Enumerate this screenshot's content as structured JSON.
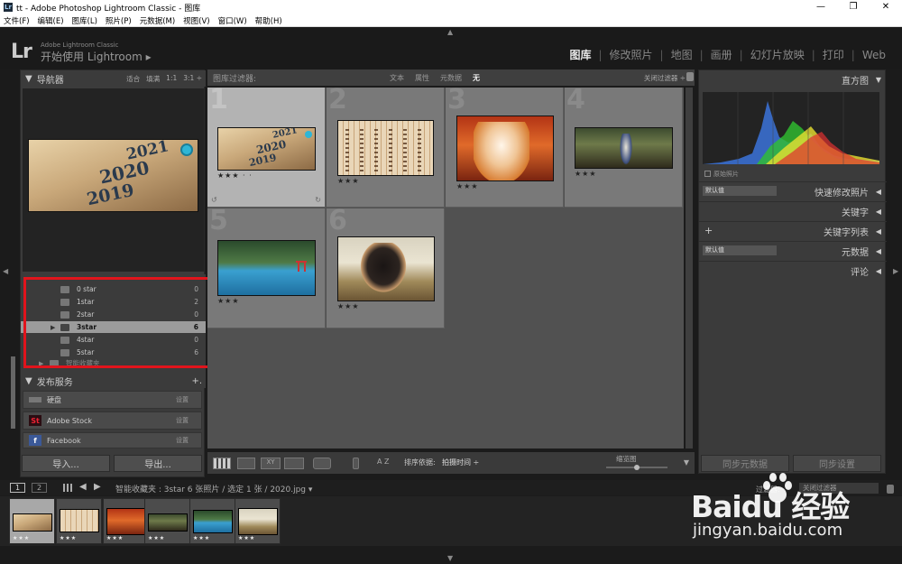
{
  "window": {
    "title": "tt - Adobe Photoshop Lightroom Classic - 图库",
    "controls": [
      "—",
      "❐",
      "✕"
    ],
    "icon": "Lr"
  },
  "menu": [
    "文件(F)",
    "编辑(E)",
    "图库(L)",
    "照片(P)",
    "元数据(M)",
    "视图(V)",
    "窗口(W)",
    "帮助(H)"
  ],
  "identity": {
    "logo": "Lr",
    "small": "Adobe Lightroom Classic",
    "big": "开始使用 Lightroom ▸"
  },
  "modules": [
    {
      "label": "图库",
      "active": true
    },
    {
      "label": "修改照片",
      "active": false
    },
    {
      "label": "地图",
      "active": false
    },
    {
      "label": "画册",
      "active": false
    },
    {
      "label": "幻灯片放映",
      "active": false
    },
    {
      "label": "打印",
      "active": false
    },
    {
      "label": "Web",
      "active": false
    }
  ],
  "navigator": {
    "title": "导航器",
    "zoom": [
      "适合",
      "填满",
      "1:1",
      "3:1 ÷"
    ],
    "preview_text": [
      "2021",
      "2020",
      "2019"
    ]
  },
  "collections": {
    "items": [
      {
        "name": "0 star",
        "count": "0",
        "selected": false
      },
      {
        "name": "1star",
        "count": "2",
        "selected": false
      },
      {
        "name": "2star",
        "count": "0",
        "selected": false
      },
      {
        "name": "3star",
        "count": "6",
        "selected": true
      },
      {
        "name": "4star",
        "count": "0",
        "selected": false
      },
      {
        "name": "5star",
        "count": "6",
        "selected": false
      }
    ],
    "partial_bottom": "智能收藏夹"
  },
  "publish": {
    "title": "发布服务",
    "add": "+.",
    "services": [
      {
        "name": "硬盘",
        "setting": "设置",
        "icon": "hard-drive-icon"
      },
      {
        "name": "Adobe Stock",
        "setting": "设置",
        "icon": "adobe-stock-icon",
        "icon_text": "St",
        "color": "#c8102e"
      },
      {
        "name": "Facebook",
        "setting": "设置",
        "icon": "facebook-icon",
        "icon_text": "f",
        "color": "#3b5998"
      }
    ]
  },
  "left_buttons": {
    "import": "导入...",
    "export": "导出..."
  },
  "filter_bar": {
    "title": "图库过滤器:",
    "options": [
      "文本",
      "属性",
      "元数据",
      "无"
    ],
    "active": "无",
    "close": "关闭过滤器 ÷"
  },
  "grid": {
    "cells": [
      {
        "num": "1",
        "stars": "★★★ · ·",
        "selected": true,
        "kind": "year"
      },
      {
        "num": "2",
        "stars": "★★★",
        "selected": false,
        "kind": "scroll"
      },
      {
        "num": "3",
        "stars": "★★★",
        "selected": false,
        "kind": "dog1"
      },
      {
        "num": "4",
        "stars": "★★★",
        "selected": false,
        "kind": "cosplay"
      },
      {
        "num": "5",
        "stars": "★★★",
        "selected": false,
        "kind": "lake"
      },
      {
        "num": "6",
        "stars": "★★★",
        "selected": false,
        "kind": "shiba"
      }
    ]
  },
  "toolbar": {
    "sort_label": "排序依据:",
    "sort_value": "拍摄时间 ÷",
    "thumb_label": "缩览图",
    "thumb_level": 0.5,
    "az": "A Z"
  },
  "right_panel": {
    "histogram": "直方图",
    "original": "原始照片",
    "quick_dev": "快速修改照片",
    "preset_default": "默认值",
    "keywords": "关键字",
    "keyword_list": "关键字列表",
    "metadata": "元数据",
    "metadata_default": "默认值",
    "comments": "评论",
    "sync_metadata": "同步元数据",
    "sync_settings": "同步设置"
  },
  "filmstrip": {
    "pages": [
      "1",
      "2"
    ],
    "path": "智能收藏夹 : 3star   6 张照片 / 选定 1 张 / 2020.jpg ▾",
    "filter_label": "过滤器:",
    "filter_value": "关闭过滤器",
    "thumbs": [
      {
        "stars": "★★★",
        "kind": "year",
        "selected": true
      },
      {
        "stars": "★★★",
        "kind": "scroll",
        "selected": false
      },
      {
        "stars": "★★★",
        "kind": "dog1",
        "selected": false
      },
      {
        "stars": "★★★",
        "kind": "cosplay",
        "selected": false
      },
      {
        "stars": "★★★",
        "kind": "lake",
        "selected": false
      },
      {
        "stars": "★★★",
        "kind": "shiba",
        "selected": false
      }
    ]
  },
  "watermark": {
    "line1": "Baidu 经验",
    "line2": "jingyan.baidu.com"
  },
  "colors": {
    "highlight": "#e1141c",
    "background": "#1b1b1b",
    "panel": "#3b3b3b"
  }
}
